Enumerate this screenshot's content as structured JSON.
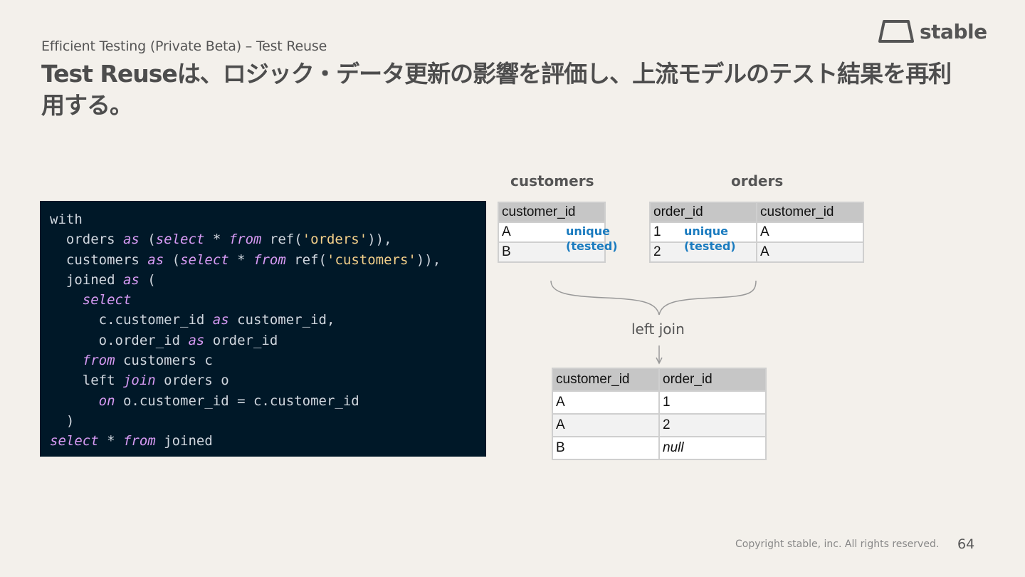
{
  "header": {
    "subtitle": "Efficient Testing (Private Beta) – Test Reuse",
    "title": "Test Reuseは、ロジック・データ更新の影響を評価し、上流モデルのテスト結果を再利用する。"
  },
  "logo": {
    "text": "stable",
    "icon": "trapezoid-logo-icon"
  },
  "code": {
    "lines": [
      [
        {
          "t": "with",
          "k": "plain"
        }
      ],
      [
        {
          "t": "  orders ",
          "k": "plain"
        },
        {
          "t": "as",
          "k": "kw"
        },
        {
          "t": " (",
          "k": "plain"
        },
        {
          "t": "select",
          "k": "kw"
        },
        {
          "t": " * ",
          "k": "plain"
        },
        {
          "t": "from",
          "k": "kw"
        },
        {
          "t": " ref(",
          "k": "plain"
        },
        {
          "t": "'orders'",
          "k": "str"
        },
        {
          "t": ")),",
          "k": "plain"
        }
      ],
      [
        {
          "t": "  customers ",
          "k": "plain"
        },
        {
          "t": "as",
          "k": "kw"
        },
        {
          "t": " (",
          "k": "plain"
        },
        {
          "t": "select",
          "k": "kw"
        },
        {
          "t": " * ",
          "k": "plain"
        },
        {
          "t": "from",
          "k": "kw"
        },
        {
          "t": " ref(",
          "k": "plain"
        },
        {
          "t": "'customers'",
          "k": "str"
        },
        {
          "t": ")),",
          "k": "plain"
        }
      ],
      [
        {
          "t": "  joined ",
          "k": "plain"
        },
        {
          "t": "as",
          "k": "kw"
        },
        {
          "t": " (",
          "k": "plain"
        }
      ],
      [
        {
          "t": "    ",
          "k": "plain"
        },
        {
          "t": "select",
          "k": "kw"
        }
      ],
      [
        {
          "t": "      c.customer_id ",
          "k": "plain"
        },
        {
          "t": "as",
          "k": "kw"
        },
        {
          "t": " customer_id,",
          "k": "plain"
        }
      ],
      [
        {
          "t": "      o.order_id ",
          "k": "plain"
        },
        {
          "t": "as",
          "k": "kw"
        },
        {
          "t": " order_id",
          "k": "plain"
        }
      ],
      [
        {
          "t": "    ",
          "k": "plain"
        },
        {
          "t": "from",
          "k": "kw"
        },
        {
          "t": " customers c",
          "k": "plain"
        }
      ],
      [
        {
          "t": "    left ",
          "k": "plain"
        },
        {
          "t": "join",
          "k": "kw"
        },
        {
          "t": " orders o",
          "k": "plain"
        }
      ],
      [
        {
          "t": "      ",
          "k": "plain"
        },
        {
          "t": "on",
          "k": "kw"
        },
        {
          "t": " o.customer_id = c.customer_id",
          "k": "plain"
        }
      ],
      [
        {
          "t": "  )",
          "k": "plain"
        }
      ],
      [
        {
          "t": "select",
          "k": "kw"
        },
        {
          "t": " * ",
          "k": "plain"
        },
        {
          "t": "from",
          "k": "kw"
        },
        {
          "t": " joined",
          "k": "plain"
        }
      ]
    ]
  },
  "customers": {
    "title": "customers",
    "headers": [
      "customer_id"
    ],
    "rows": [
      [
        "A"
      ],
      [
        "B"
      ]
    ],
    "note_line1": "unique",
    "note_line2": "(tested)"
  },
  "orders": {
    "title": "orders",
    "headers": [
      "order_id",
      "customer_id"
    ],
    "rows": [
      [
        "1",
        "A"
      ],
      [
        "2",
        "A"
      ]
    ],
    "note_line1": "unique",
    "note_line2": "(tested)"
  },
  "join": {
    "label": "left join"
  },
  "result": {
    "headers": [
      "customer_id",
      "order_id"
    ],
    "rows": [
      [
        "A",
        "1"
      ],
      [
        "A",
        "2"
      ],
      [
        "B",
        "null"
      ]
    ]
  },
  "footer": {
    "copyright": "Copyright stable, inc. All rights reserved.",
    "page": "64"
  }
}
